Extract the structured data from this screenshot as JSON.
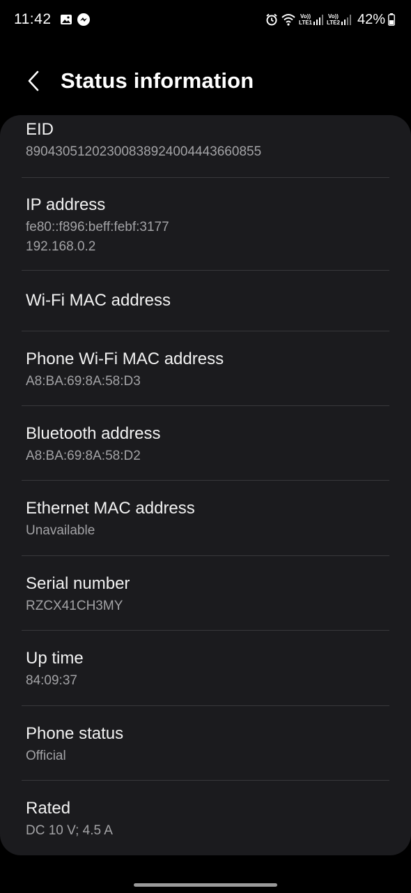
{
  "status_bar": {
    "time": "11:42",
    "lte1": "LTE1",
    "lte2": "LTE2",
    "volte1": "Vo))",
    "volte2": "Vo))",
    "battery": "42%"
  },
  "header": {
    "title": "Status information"
  },
  "items": [
    {
      "title": "EID",
      "values": [
        "89043051202300838924004443660855"
      ]
    },
    {
      "title": "IP address",
      "values": [
        "fe80::f896:beff:febf:3177",
        "192.168.0.2"
      ]
    },
    {
      "title": "Wi-Fi MAC address",
      "values": []
    },
    {
      "title": "Phone Wi-Fi MAC address",
      "values": [
        "A8:BA:69:8A:58:D3"
      ]
    },
    {
      "title": "Bluetooth address",
      "values": [
        "A8:BA:69:8A:58:D2"
      ]
    },
    {
      "title": "Ethernet MAC address",
      "values": [
        "Unavailable"
      ]
    },
    {
      "title": "Serial number",
      "values": [
        "RZCX41CH3MY"
      ]
    },
    {
      "title": "Up time",
      "values": [
        "84:09:37"
      ]
    },
    {
      "title": "Phone status",
      "values": [
        "Official"
      ]
    },
    {
      "title": "Rated",
      "values": [
        "DC 10 V; 4.5 A"
      ]
    }
  ],
  "colors": {
    "background": "#000000",
    "card": "#1b1b1e",
    "title_text": "#f2f2f2",
    "value_text": "#a3a3a6",
    "divider": "#38383b"
  }
}
